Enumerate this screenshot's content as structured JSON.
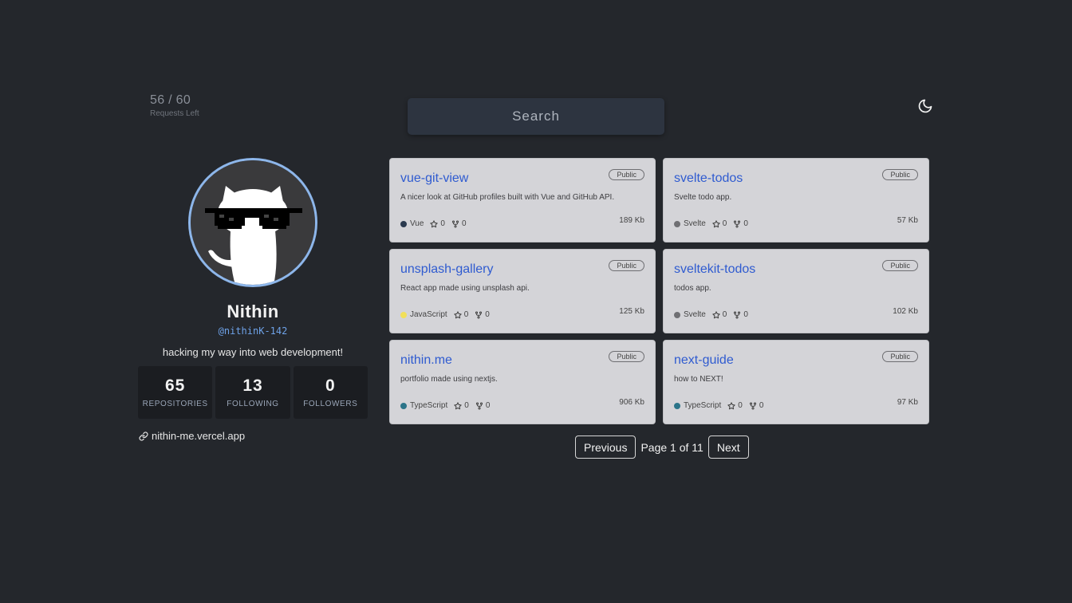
{
  "rate_limit": {
    "count": "56 / 60",
    "label": "Requests Left"
  },
  "search": {
    "placeholder": "Search"
  },
  "theme_toggle": {
    "icon": "moon-icon"
  },
  "profile": {
    "avatar_icon": "octocat-with-sunglasses",
    "name": "Nithin",
    "handle": "@nithinK-142",
    "bio": "hacking my way into web development!",
    "stats": [
      {
        "value": "65",
        "label": "REPOSITORIES"
      },
      {
        "value": "13",
        "label": "FOLLOWING"
      },
      {
        "value": "0",
        "label": "FOLLOWERS"
      }
    ],
    "website": "nithin-me.vercel.app"
  },
  "repos": [
    {
      "name": "vue-git-view",
      "visibility": "Public",
      "description": "A nicer look at GitHub profiles built with Vue and GitHub API.",
      "language": "Vue",
      "language_color": "#2b3a4f",
      "stars": "0",
      "forks": "0",
      "size": "189 Kb"
    },
    {
      "name": "svelte-todos",
      "visibility": "Public",
      "description": "Svelte todo app.",
      "language": "Svelte",
      "language_color": "#6f6f73",
      "stars": "0",
      "forks": "0",
      "size": "57 Kb"
    },
    {
      "name": "unsplash-gallery",
      "visibility": "Public",
      "description": "React app made using unsplash api.",
      "language": "JavaScript",
      "language_color": "#f1e05a",
      "stars": "0",
      "forks": "0",
      "size": "125 Kb"
    },
    {
      "name": "sveltekit-todos",
      "visibility": "Public",
      "description": "todos app.",
      "language": "Svelte",
      "language_color": "#6f6f73",
      "stars": "0",
      "forks": "0",
      "size": "102 Kb"
    },
    {
      "name": "nithin.me",
      "visibility": "Public",
      "description": "portfolio made using nextjs.",
      "language": "TypeScript",
      "language_color": "#2b7489",
      "stars": "0",
      "forks": "0",
      "size": "906 Kb"
    },
    {
      "name": "next-guide",
      "visibility": "Public",
      "description": "how to NEXT!",
      "language": "TypeScript",
      "language_color": "#2b7489",
      "stars": "0",
      "forks": "0",
      "size": "97 Kb"
    }
  ],
  "pagination": {
    "previous_label": "Previous",
    "page_info": "Page 1 of 11",
    "next_label": "Next"
  }
}
